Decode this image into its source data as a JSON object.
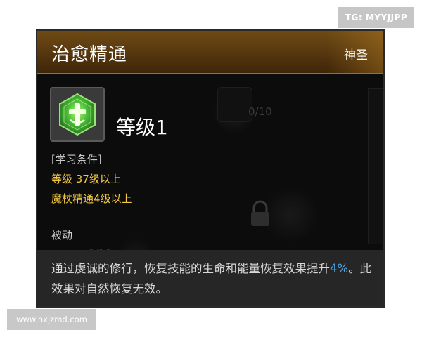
{
  "watermarks": {
    "tg": "TG: MYYJJPP",
    "url": "www.hxjzmd.com"
  },
  "tooltip": {
    "title": "治愈精通",
    "type": "神圣",
    "icon": "holy-cross-hexagon-icon",
    "level": "等级1",
    "background_ghost_text": [
      "0/10",
      "0/10"
    ],
    "requirements_header": "[学习条件]",
    "requirements": [
      "等级 37级以上",
      "魔杖精通4级以上"
    ],
    "skill_kind": "被动",
    "description_part1": "通过虔诚的修行，恢复技能的生命和能量恢复效果提升",
    "description_value": "4%",
    "description_part2": "。此效果对自然恢复无效。",
    "colors": {
      "header_brown": "#5a3a10",
      "requirement_yellow": "#f2c744",
      "value_blue": "#4aa8e8",
      "icon_green": "#4cc23a"
    }
  }
}
